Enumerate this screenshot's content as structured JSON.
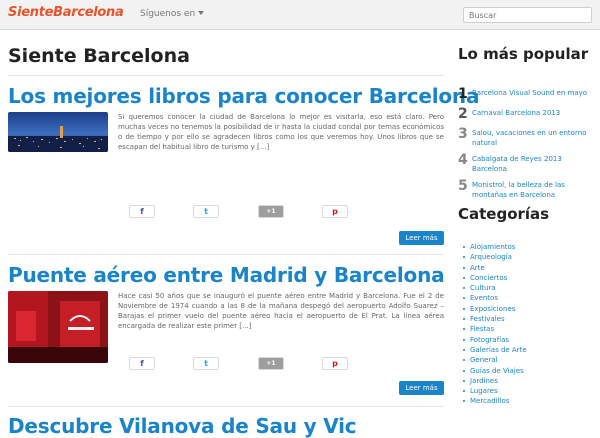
{
  "navbar": {
    "logo_part1": "Siente",
    "logo_part2": "Barcelona",
    "follow_label": "Síguenos en",
    "search_placeholder": "Buscar"
  },
  "main": {
    "site_title": "Siente Barcelona",
    "more_label": "Leer más",
    "share": {
      "facebook": "f",
      "twitter": "t",
      "gplus": "+1",
      "pinterest": "p"
    },
    "posts": [
      {
        "title": "Los mejores libros para conocer Barcelona",
        "excerpt": "Si queremos conocer la ciudad de Barcelona lo mejor es visitarla, eso está claro. Pero muchas veces no tenemos la posibilidad de ir hasta la ciudad condal por temas económicos o de tiempo y por ello se agradecen libros como los que veremos hoy. Unos libros que se escapan del habitual libro de turismo y [...]"
      },
      {
        "title": "Puente aéreo entre Madrid y Barcelona",
        "excerpt": "Hace casi 50 años que se inauguró el puente aéreo entre Madrid y Barcelona. Fue el 2 de Noviembre de 1974 cuando a las 8 de la mañana despegó del aeropuerto Adolfo Suarez – Barajas el primer vuelo del puente aéreo hacia el aeropuerto de El Prat. La línea aérea encargada de realizar este primer [...]"
      },
      {
        "title": "Descubre Vilanova de Sau y Vic"
      }
    ]
  },
  "sidebar": {
    "popular_heading": "Lo más popular",
    "popular": [
      {
        "num": "1",
        "label": "Barcelona Visual Sound en mayo"
      },
      {
        "num": "2",
        "label": "Carnaval Barcelona 2013"
      },
      {
        "num": "3",
        "label": "Salou, vacaciones en un entorno natural"
      },
      {
        "num": "4",
        "label": "Cabalgata de Reyes 2013 Barcelona"
      },
      {
        "num": "5",
        "label": "Monistrol, la belleza de las montañas en Barcelona"
      }
    ],
    "categories_heading": "Categorías",
    "categories": [
      "Alojamientos",
      "Arqueología",
      "Arte",
      "Conciertos",
      "Cultura",
      "Eventos",
      "Exposiciones",
      "Festivales",
      "Fiestas",
      "Fotografías",
      "Galerías de Arte",
      "General",
      "Guías de Viajes",
      "Jardines",
      "Lugares",
      "Mercadillos"
    ]
  },
  "colors": {
    "link": "#1a84c8",
    "logo": "#e8532a",
    "button": "#1a84c8"
  }
}
